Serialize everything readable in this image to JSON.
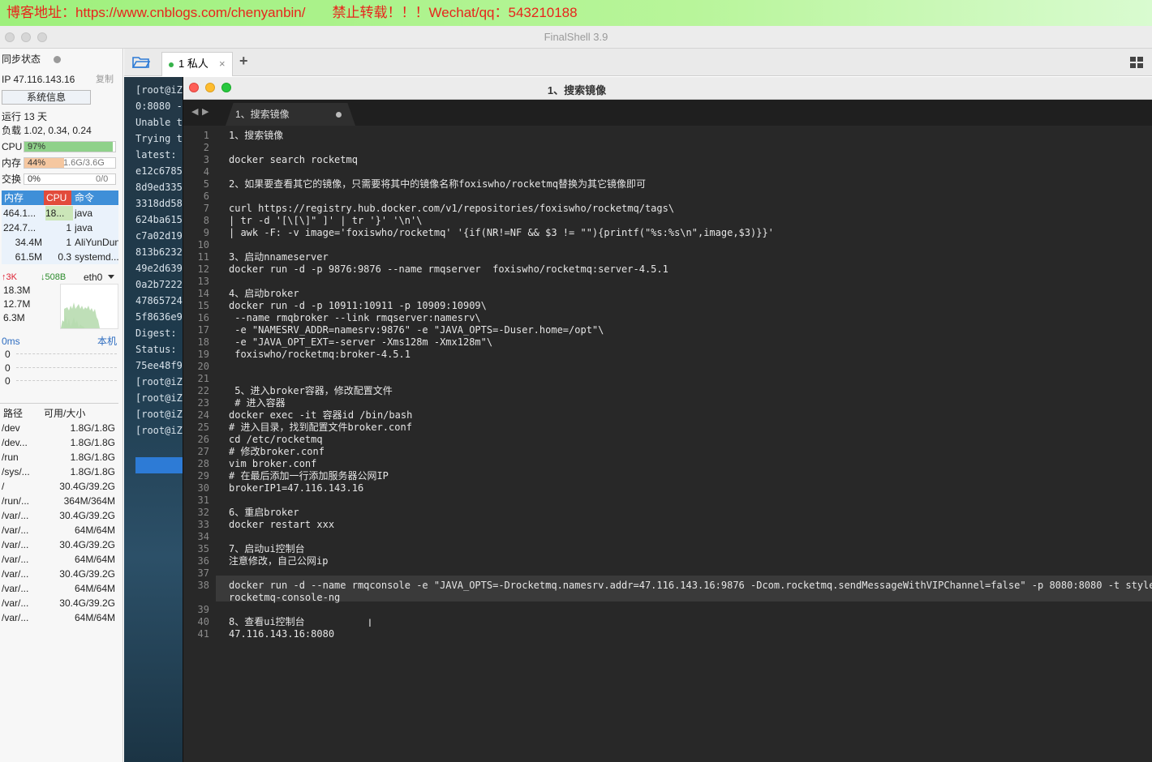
{
  "banner": {
    "text": "博客地址：https://www.cnblogs.com/chenyanbin/       禁止转载！！！Wechat/qq：543210188"
  },
  "app": {
    "title": "FinalShell 3.9"
  },
  "sidebar": {
    "sync_label": "同步状态",
    "ip_label": "IP 47.116.143.16",
    "copy_label": "复制",
    "sysinfo_button": "系统信息",
    "uptime": "运行 13 天",
    "load": "负载 1.02, 0.34, 0.24",
    "cpu_label": "CPU",
    "cpu_value": "97%",
    "cpu_fraction": 0.97,
    "mem_label": "内存",
    "mem_value": "44%",
    "mem_detail": "1.6G/3.6G",
    "mem_fraction": 0.44,
    "swap_label": "交换",
    "swap_value": "0%",
    "swap_detail": "0/0",
    "proc_headers": {
      "mem": "内存",
      "cpu": "CPU",
      "cmd": "命令"
    },
    "processes": [
      {
        "mem": "464.1...",
        "cpu": "18...",
        "cmd": "java"
      },
      {
        "mem": "224.7...",
        "cpu": "1",
        "cmd": "java"
      },
      {
        "mem": "34.4M",
        "cpu": "1",
        "cmd": "AliYunDun"
      },
      {
        "mem": "61.5M",
        "cpu": "0.3",
        "cmd": "systemd..."
      }
    ],
    "net_up": "↑3K",
    "net_down": "↓508B",
    "net_iface": "eth0",
    "net_scale": [
      "18.3M",
      "12.7M",
      "6.3M"
    ],
    "ping": "0ms",
    "ping_target": "本机",
    "ping_values": [
      "0",
      "0",
      "0"
    ],
    "disk_headers": {
      "path": "路径",
      "size": "可用/大小"
    },
    "disks": [
      {
        "path": "/dev",
        "size": "1.8G/1.8G"
      },
      {
        "path": "/dev...",
        "size": "1.8G/1.8G"
      },
      {
        "path": "/run",
        "size": "1.8G/1.8G"
      },
      {
        "path": "/sys/...",
        "size": "1.8G/1.8G"
      },
      {
        "path": "/",
        "size": "30.4G/39.2G"
      },
      {
        "path": "/run/...",
        "size": "364M/364M"
      },
      {
        "path": "/var/...",
        "size": "30.4G/39.2G"
      },
      {
        "path": "/var/...",
        "size": "64M/64M"
      },
      {
        "path": "/var/...",
        "size": "30.4G/39.2G"
      },
      {
        "path": "/var/...",
        "size": "64M/64M"
      },
      {
        "path": "/var/...",
        "size": "30.4G/39.2G"
      },
      {
        "path": "/var/...",
        "size": "64M/64M"
      },
      {
        "path": "/var/...",
        "size": "30.4G/39.2G"
      },
      {
        "path": "/var/...",
        "size": "64M/64M"
      }
    ]
  },
  "tabs": {
    "session_label": "1 私人",
    "close": "×",
    "add": "+"
  },
  "terminal": {
    "lines": [
      "[root@iZ",
      "0:8080 -",
      "Unable t",
      "Trying t",
      "latest:",
      "e12c6785",
      "8d9ed335",
      "3318dd58",
      "624ba615",
      "c7a02d19",
      "813b6232",
      "49e2d639",
      "0a2b7222",
      "47865724",
      "5f8636e9",
      "Digest:",
      "Status:",
      "75ee48f9",
      "[root@iZ",
      "[root@iZ",
      "[root@iZ",
      "[root@iZ"
    ]
  },
  "editor": {
    "window_title": "1、搜索镜像",
    "tab_label": "1、搜索镜像",
    "lines": [
      "1、搜索镜像",
      "",
      "docker search rocketmq",
      "",
      "2、如果要查看其它的镜像，只需要将其中的镜像名称foxiswho/rocketmq替换为其它镜像即可",
      "",
      "curl https://registry.hub.docker.com/v1/repositories/foxiswho/rocketmq/tags\\",
      "| tr -d '[\\[\\]\" ]' | tr '}' '\\n'\\",
      "| awk -F: -v image='foxiswho/rocketmq' '{if(NR!=NF && $3 != \"\"){printf(\"%s:%s\\n\",image,$3)}}'",
      "",
      "3、启动nnameserver",
      "docker run -d -p 9876:9876 --name rmqserver  foxiswho/rocketmq:server-4.5.1",
      "",
      "4、启动broker",
      "docker run -d -p 10911:10911 -p 10909:10909\\",
      " --name rmqbroker --link rmqserver:namesrv\\",
      " -e \"NAMESRV_ADDR=namesrv:9876\" -e \"JAVA_OPTS=-Duser.home=/opt\"\\",
      " -e \"JAVA_OPT_EXT=-server -Xms128m -Xmx128m\"\\",
      " foxiswho/rocketmq:broker-4.5.1",
      "",
      "",
      " 5、进入broker容器，修改配置文件",
      " # 进入容器",
      "docker exec -it 容器id /bin/bash",
      "# 进入目录，找到配置文件broker.conf",
      "cd /etc/rocketmq",
      "# 修改broker.conf",
      "vim broker.conf",
      "# 在最后添加一行添加服务器公网IP",
      "brokerIP1=47.116.143.16",
      "",
      "6、重启broker",
      "docker restart xxx",
      "",
      "7、启动ui控制台",
      "注意修改，自己公网ip",
      "",
      "docker run -d --name rmqconsole -e \"JAVA_OPTS=-Drocketmq.namesrv.addr=47.116.143.16:9876 -Dcom.rocketmq.sendMessageWithVIPChannel=false\" -p 8080:8080 -t styletang/",
      "rocketmq-console-ng",
      "",
      "8、查看ui控制台",
      "47.116.143.16:8080"
    ]
  }
}
